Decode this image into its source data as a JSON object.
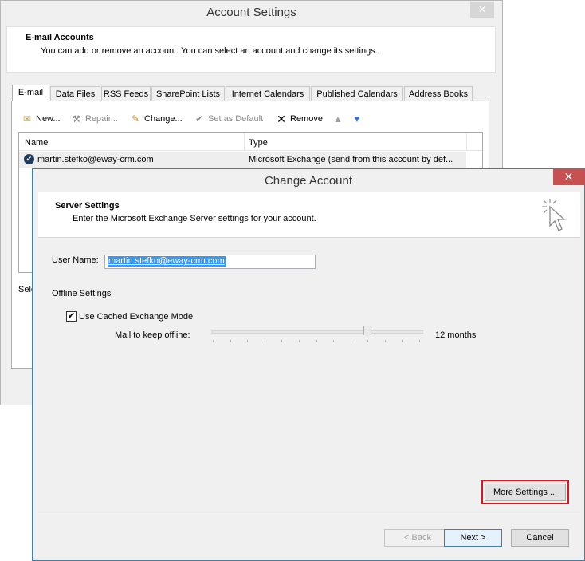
{
  "account_settings": {
    "title": "Account Settings",
    "close_glyph": "✕",
    "header_title": "E-mail Accounts",
    "header_desc": "You can add or remove an account. You can select an account and change its settings.",
    "tabs": [
      "E-mail",
      "Data Files",
      "RSS Feeds",
      "SharePoint Lists",
      "Internet Calendars",
      "Published Calendars",
      "Address Books"
    ],
    "toolbar": {
      "new": "New...",
      "repair": "Repair...",
      "change": "Change...",
      "set_default": "Set as Default",
      "remove": "Remove"
    },
    "columns": {
      "name": "Name",
      "type": "Type"
    },
    "accounts": [
      {
        "name": "martin.stefko@eway-crm.com",
        "type": "Microsoft Exchange (send from this account by def..."
      }
    ],
    "clipped_label": "Sele"
  },
  "change_account": {
    "title": "Change Account",
    "close_glyph": "✕",
    "header_title": "Server Settings",
    "header_desc": "Enter the Microsoft Exchange Server settings for your account.",
    "user_name_label": "User Name:",
    "user_name_value": "martin.stefko@eway-crm.com",
    "offline_section": "Offline Settings",
    "cached_mode_label": "Use Cached Exchange Mode",
    "cached_mode_checked": true,
    "mail_offline_label": "Mail to keep offline:",
    "mail_offline_value": "12 months",
    "buttons": {
      "more_settings": "More Settings ...",
      "back": "< Back",
      "next": "Next >",
      "cancel": "Cancel"
    }
  },
  "colors": {
    "highlight_box": "#e0131f",
    "selection": "#3399ff",
    "dialog_border": "#3c7fb1",
    "close_red": "#c75050"
  }
}
